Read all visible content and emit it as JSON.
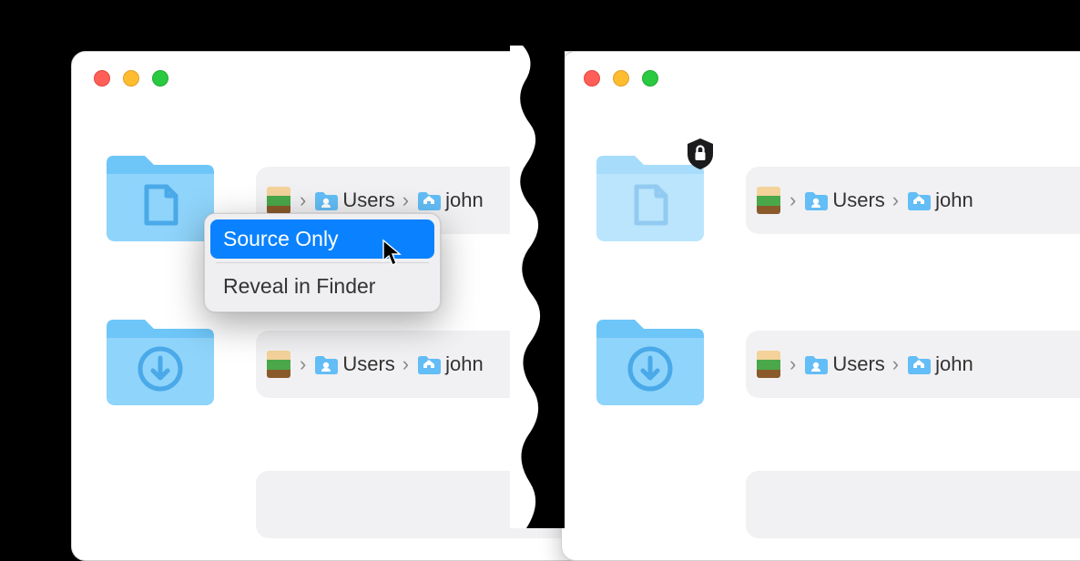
{
  "windows": {
    "left": {
      "context_menu": {
        "item_selected": "Source Only",
        "item_other": "Reveal in Finder"
      }
    }
  },
  "path": {
    "users_label": "Users",
    "username": "john"
  }
}
